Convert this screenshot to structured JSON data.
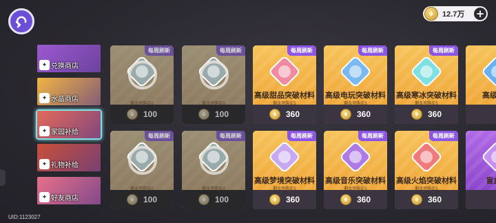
{
  "currency": {
    "amount": "12.7万",
    "icon": "coin-icon"
  },
  "sidebar": {
    "items": [
      {
        "label": "兑换商店",
        "icon": "exchange-icon",
        "bg": "#9b59d0",
        "active": false
      },
      {
        "label": "水晶商店",
        "icon": "crystal-icon",
        "bg": "#f0b443",
        "active": false
      },
      {
        "label": "家园补给",
        "icon": "home-icon",
        "bg": "#e46a5a",
        "active": true
      },
      {
        "label": "礼物补给",
        "icon": "gift-icon",
        "bg": "#c8503a",
        "active": false
      },
      {
        "label": "好友商店",
        "icon": "friend-icon",
        "bg": "#e7708a",
        "active": false
      }
    ]
  },
  "shop": {
    "weekly_badge": "每周刷新",
    "cards": [
      {
        "name": "",
        "limit": "剩余可购买0",
        "price": "100",
        "sold_out": true,
        "art": "box-icon",
        "color": "#9aa"
      },
      {
        "name": "",
        "limit": "剩余可购买0",
        "price": "100",
        "sold_out": true,
        "art": "box-icon",
        "color": "#9aa"
      },
      {
        "name": "高级甜品突破材料",
        "limit": "剩余可购买5",
        "price": "360",
        "sold_out": false,
        "art": "cake-icon",
        "color": "#f08aa0"
      },
      {
        "name": "高级电玩突破材料",
        "limit": "剩余可购买5",
        "price": "360",
        "sold_out": false,
        "art": "gamepad-icon",
        "color": "#7ab8f0"
      },
      {
        "name": "高级寒冰突破材料",
        "limit": "剩余可购买5",
        "price": "360",
        "sold_out": false,
        "art": "ice-icon",
        "color": "#7ee0e0"
      },
      {
        "name": "高级水流",
        "limit": "",
        "price": "",
        "sold_out": false,
        "art": "water-icon",
        "color": "#6ab0f0"
      },
      {
        "name": "",
        "limit": "剩余可购买0",
        "price": "100",
        "sold_out": true,
        "art": "box-icon",
        "color": "#9aa"
      },
      {
        "name": "",
        "limit": "剩余可购买0",
        "price": "100",
        "sold_out": true,
        "art": "box-icon",
        "color": "#9aa"
      },
      {
        "name": "高级梦境突破材料",
        "limit": "剩余可购买5",
        "price": "360",
        "sold_out": false,
        "art": "dream-icon",
        "color": "#c8a8f0"
      },
      {
        "name": "高级音乐突破材料",
        "limit": "剩余可购买5",
        "price": "360",
        "sold_out": false,
        "art": "music-icon",
        "color": "#b07ae6"
      },
      {
        "name": "高级火焰突破材料",
        "limit": "剩余可购买5",
        "price": "360",
        "sold_out": false,
        "art": "fire-icon",
        "color": "#f07a7a"
      },
      {
        "name": "盲盒市",
        "limit": "",
        "price": "",
        "sold_out": false,
        "art": "blindbox-icon",
        "color": "#c890f0"
      }
    ]
  },
  "footer": {
    "uid": "UID:1123027"
  }
}
